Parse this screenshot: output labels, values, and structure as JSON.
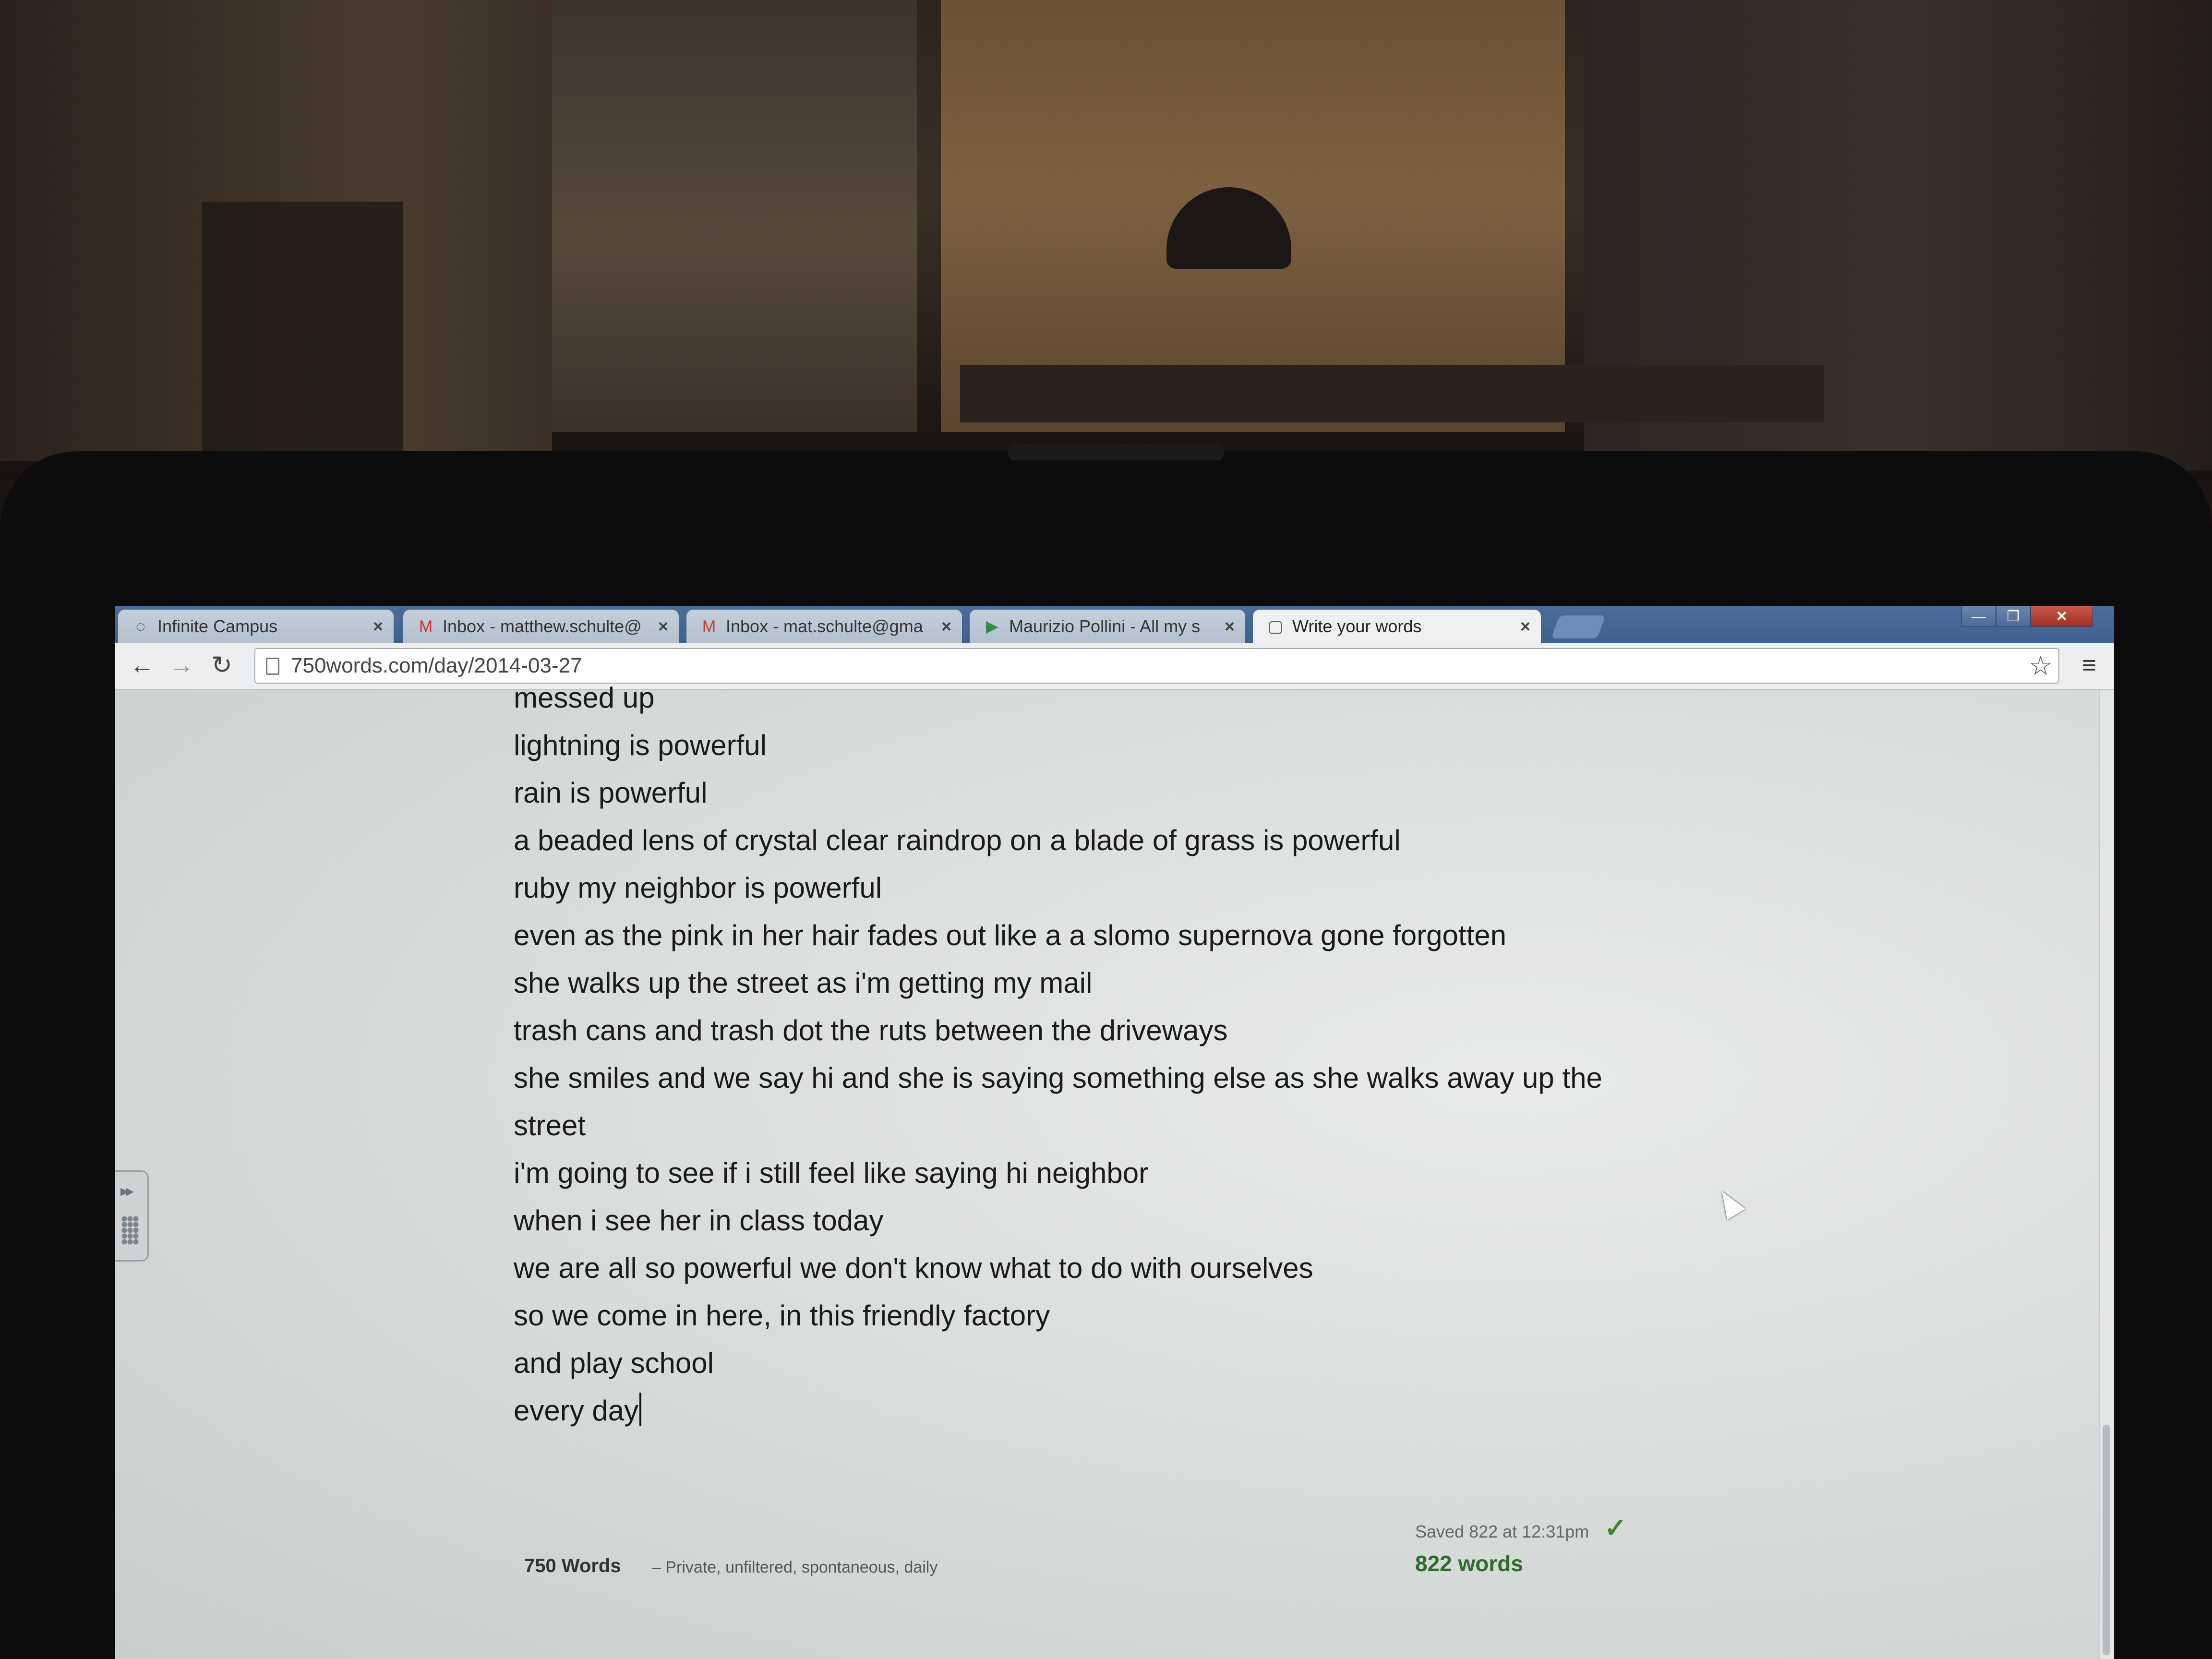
{
  "browser": {
    "tabs": [
      {
        "label": "Infinite Campus",
        "icon": "loading-spinner-icon",
        "active": false
      },
      {
        "label": "Inbox - matthew.schulte@",
        "icon": "gmail-icon",
        "active": false
      },
      {
        "label": "Inbox - mat.schulte@gma",
        "icon": "gmail-icon",
        "active": false
      },
      {
        "label": "Maurizio Pollini - All my s",
        "icon": "play-icon",
        "active": false
      },
      {
        "label": "Write your words",
        "icon": "page-icon",
        "active": true
      }
    ],
    "tab_close_glyph": "×",
    "window_controls": {
      "minimize": "—",
      "maximize": "❐",
      "close": "✕"
    },
    "url": "750words.com/day/2014-03-27",
    "nav": {
      "back": "←",
      "forward": "→",
      "reload": "↻",
      "bookmark": "☆",
      "menu": "≡"
    }
  },
  "editor": {
    "lines": [
      "messed up",
      "lightning is powerful",
      "rain is powerful",
      "a beaded lens of crystal clear raindrop on a blade of grass is powerful",
      "ruby my neighbor is powerful",
      "even as the pink in her hair fades out like a a slomo supernova gone forgotten",
      "she walks up the street as i'm getting my mail",
      "trash cans and trash dot the ruts between the driveways",
      "she smiles and we say hi and she is saying something else as she walks away up the",
      "street",
      "i'm going to see if i still feel like saying hi neighbor",
      "when i see her in class today",
      "we are all so powerful we don't know what to do with ourselves",
      "so we come in here, in this friendly factory",
      "and play school",
      "every day"
    ]
  },
  "footer": {
    "brand": "750 Words",
    "tagline": "– Private, unfiltered, spontaneous, daily",
    "saved_status": "Saved 822 at 12:31pm",
    "check": "✓",
    "word_count": "822 words"
  },
  "colors": {
    "tabstrip": "#4d6d99",
    "active_tab": "#eef0f1",
    "word_count_green": "#2f6b2a"
  }
}
